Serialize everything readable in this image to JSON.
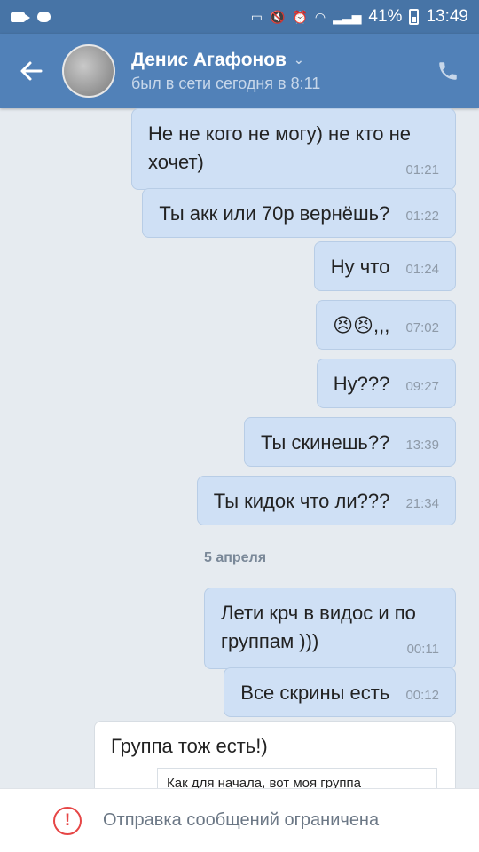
{
  "statusbar": {
    "battery": "41%",
    "time": "13:49",
    "icons": [
      "video-icon",
      "chat-icon",
      "cast-icon",
      "mute-icon",
      "alarm-icon",
      "wifi-icon",
      "signal-icon",
      "battery-icon"
    ]
  },
  "header": {
    "name": "Денис Агафонов",
    "status": "был в сети сегодня в 8:11",
    "back_icon": "arrow-left-icon",
    "call_icon": "phone-icon",
    "dropdown_icon": "chevron-down-icon"
  },
  "messages": [
    {
      "text": "Не не кого не могу) не кто не хочет)",
      "time": "01:21"
    },
    {
      "text": "Ты акк или 70р вернёшь?",
      "time": "01:22"
    },
    {
      "text": "Ну что",
      "time": "01:24"
    },
    {
      "text": "😣😣,,,",
      "time": "07:02"
    },
    {
      "text": "Ну???",
      "time": "09:27"
    },
    {
      "text": "Ты скинешь??",
      "time": "13:39"
    },
    {
      "text": "Ты кидок что ли???",
      "time": "21:34"
    },
    {
      "text": "Лети крч в видос и по группам )))",
      "time": "00:11"
    },
    {
      "text": "Все скрины есть",
      "time": "00:12"
    },
    {
      "text": "Группа тож есть!)"
    }
  ],
  "date_separator": "5 апреля",
  "link_preview": {
    "text": "Как для начала, вот моя группа"
  },
  "footer": {
    "text": "Отправка сообщений ограничена",
    "icon": "alert-circle-icon"
  },
  "colors": {
    "header": "#5181b8",
    "statusbar": "#4774a6",
    "background": "#e6ebf0",
    "outgoing_bubble": "#cfe0f5",
    "incoming_bubble": "#ffffff",
    "warning": "#e64646"
  }
}
